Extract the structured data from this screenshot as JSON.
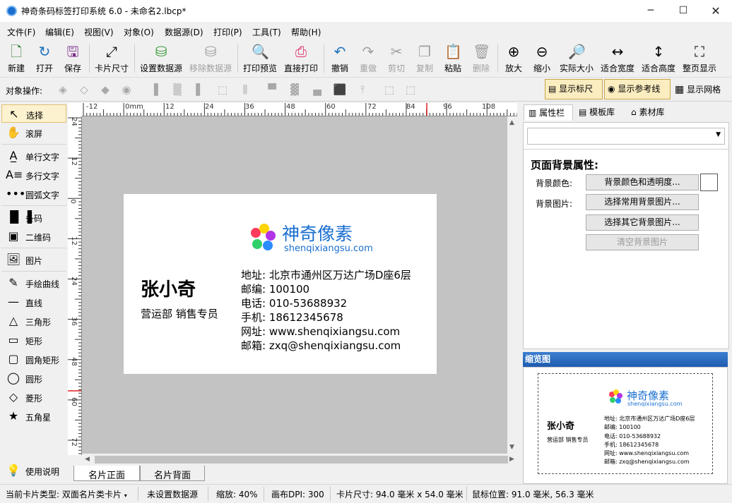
{
  "window": {
    "title": "神奇条码标签打印系统 6.0 - 未命名2.lbcp*"
  },
  "menu": [
    "文件(F)",
    "编辑(E)",
    "视图(V)",
    "对象(O)",
    "数据源(D)",
    "打印(P)",
    "工具(T)",
    "帮助(H)"
  ],
  "toolbar": {
    "new": "新建",
    "open": "打开",
    "save": "保存",
    "card_size": "卡片尺寸",
    "set_datasource": "设置数据源",
    "remove_datasource": "移除数据源",
    "print_preview": "打印预览",
    "direct_print": "直接打印",
    "undo": "撤销",
    "redo": "重做",
    "cut": "剪切",
    "copy": "复制",
    "paste": "粘贴",
    "delete": "删除",
    "zoom_in": "放大",
    "zoom_out": "缩小",
    "actual_size": "实际大小",
    "fit_width": "适合宽度",
    "fit_height": "适合高度",
    "fit_page": "整页显示"
  },
  "objbar": {
    "label": "对象操作:",
    "show_ruler": "显示标尺",
    "show_guides": "显示参考线",
    "show_grid": "显示网格"
  },
  "tools": [
    "选择",
    "滚屏",
    "单行文字",
    "多行文字",
    "圆弧文字",
    "条码",
    "二维码",
    "图片",
    "手绘曲线",
    "直线",
    "三角形",
    "矩形",
    "圆角矩形",
    "圆形",
    "菱形",
    "五角星"
  ],
  "help": "使用说明",
  "hruler": [
    "-12",
    "0mm",
    "12",
    "24",
    "36",
    "48",
    "60",
    "72",
    "84",
    "96",
    "108"
  ],
  "vruler": [
    "24",
    "12",
    "0",
    "12",
    "24",
    "36",
    "48",
    "60",
    "72"
  ],
  "card": {
    "brand": "神奇像素",
    "brand_url": "shenqixiangsu.com",
    "name": "张小奇",
    "dept": "营运部 销售专员",
    "lines": [
      "地址: 北京市通州区万达广场D座6层",
      "邮编: 100100",
      "电话: 010-53688932",
      "手机: 18612345678",
      "网址: www.shenqixiangsu.com",
      "邮箱: zxq@shenqixiangsu.com"
    ]
  },
  "page_tabs": [
    "名片正面",
    "名片背面"
  ],
  "rpanel": {
    "tabs": [
      "属性栏",
      "模板库",
      "素材库"
    ],
    "section": "页面背景属性:",
    "bg_color_label": "背景颜色:",
    "bg_image_label": "背景图片:",
    "btn_color": "背景颜色和透明度...",
    "btn_common": "选择常用背景图片...",
    "btn_other": "选择其它背景图片...",
    "btn_clear": "清空背景图片",
    "preview_title": "缩览图"
  },
  "status": {
    "card_type": "当前卡片类型: 双面名片类卡片",
    "datasource": "未设置数据源",
    "zoom": "缩放: 40%",
    "dpi": "画布DPI: 300",
    "card_size": "卡片尺寸: 94.0 毫米 x 54.0 毫米",
    "mouse": "鼠标位置: 91.0 毫米, 56.3 毫米"
  },
  "colors": {
    "accent": "#1a6fd0",
    "dot_red": "#ff3b5c",
    "dot_yellow": "#ffd400",
    "dot_purple": "#b233e8",
    "dot_blue": "#2a8cff",
    "dot_green": "#2fd06a"
  }
}
